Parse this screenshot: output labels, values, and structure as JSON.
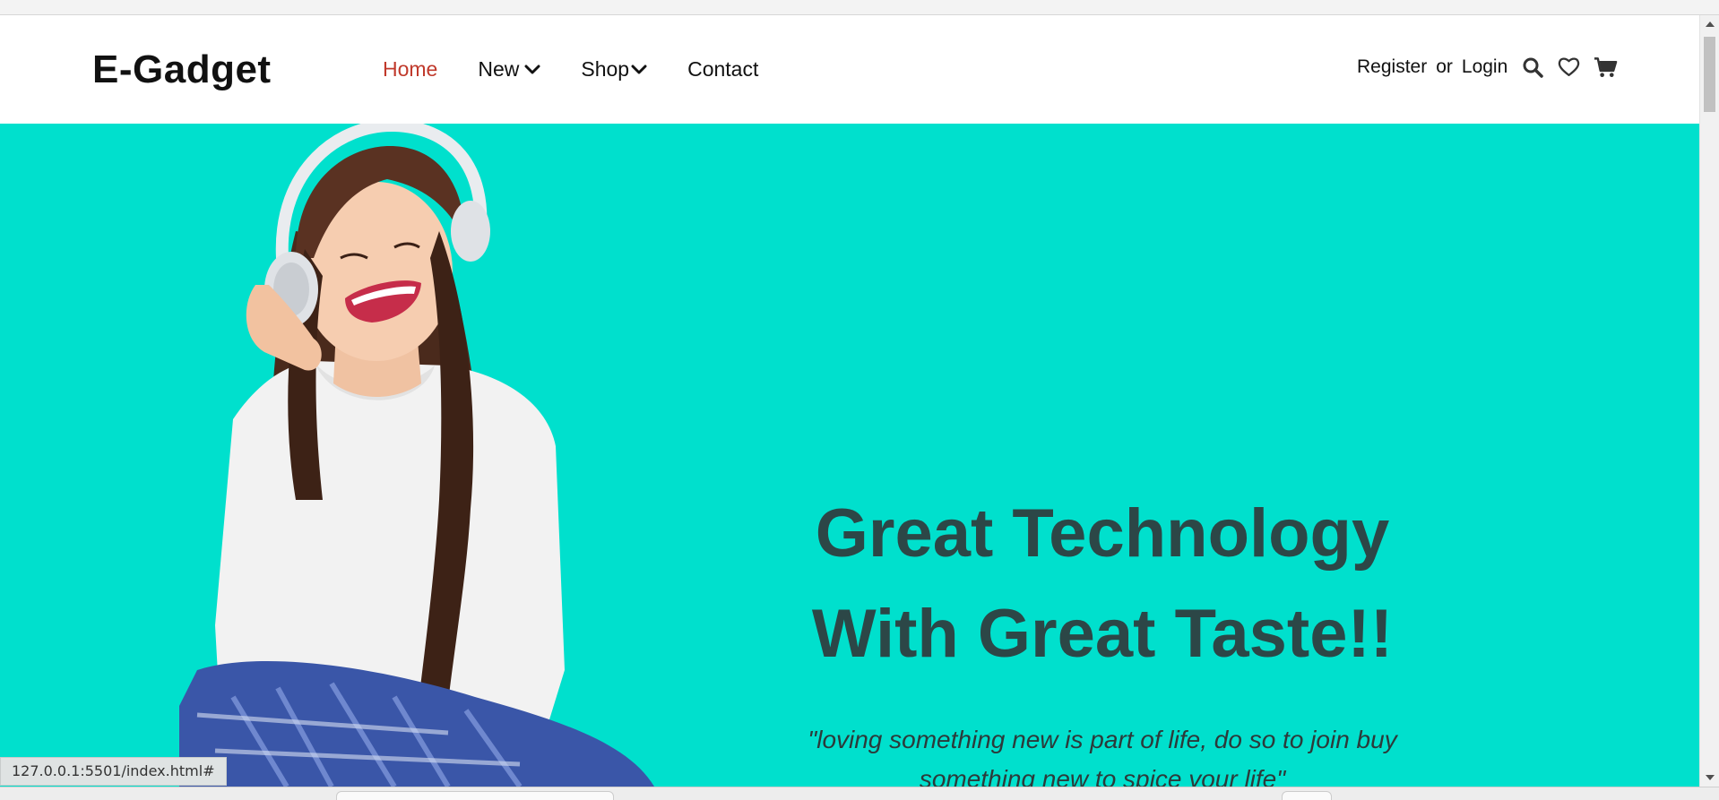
{
  "brand": {
    "name": "E-Gadget"
  },
  "nav": {
    "items": [
      {
        "label": "Home",
        "active": true,
        "has_dropdown": false
      },
      {
        "label": "New",
        "active": false,
        "has_dropdown": true
      },
      {
        "label": "Shop",
        "active": false,
        "has_dropdown": true
      },
      {
        "label": "Contact",
        "active": false,
        "has_dropdown": false
      }
    ],
    "register_label": "Register",
    "or_label": "or",
    "login_label": "Login",
    "icons": [
      "search-icon",
      "heart-icon",
      "cart-icon"
    ]
  },
  "hero": {
    "headline_line1": "Great Technology",
    "headline_line2": "With Great Taste!!",
    "quote": "\"loving something new is part of life, do so to join buy something new to spice your life\"",
    "background_color": "#00e0cd",
    "headline_color": "#2c4747"
  },
  "status": {
    "url": "127.0.0.1:5501/index.html#"
  },
  "colors": {
    "active_link": "#c0392b",
    "text": "#111111"
  }
}
